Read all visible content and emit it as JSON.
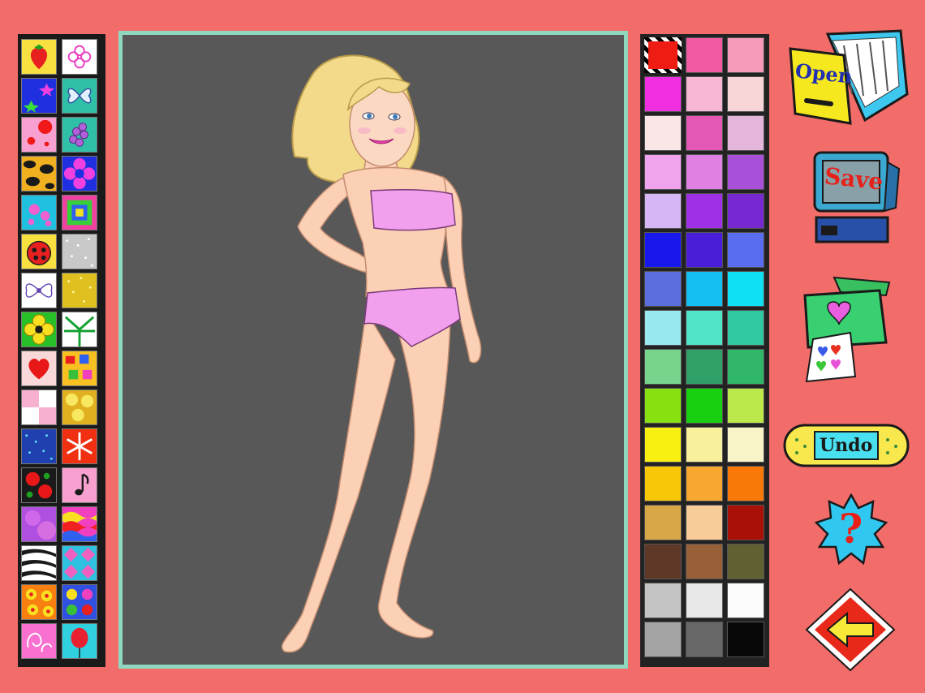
{
  "patterns": [
    {
      "name": "strawberry",
      "icon": "strawberry-icon"
    },
    {
      "name": "flower-outline",
      "icon": "flower-icon"
    },
    {
      "name": "stars-splat",
      "icon": "stars-icon"
    },
    {
      "name": "butterfly",
      "icon": "butterfly-icon"
    },
    {
      "name": "pink-dots",
      "icon": "dots-icon"
    },
    {
      "name": "grapes",
      "icon": "grapes-icon"
    },
    {
      "name": "leopard",
      "icon": "leopard-icon"
    },
    {
      "name": "purple-flower",
      "icon": "purple-flower-icon"
    },
    {
      "name": "poodle",
      "icon": "poodle-icon"
    },
    {
      "name": "squares",
      "icon": "squares-icon"
    },
    {
      "name": "ladybug",
      "icon": "ladybug-icon"
    },
    {
      "name": "silver-glitter",
      "icon": "glitter-icon"
    },
    {
      "name": "bow",
      "icon": "bow-icon"
    },
    {
      "name": "gold-glitter",
      "icon": "gold-glitter-icon"
    },
    {
      "name": "yellow-flower",
      "icon": "yellow-flower-icon"
    },
    {
      "name": "palm-leaves",
      "icon": "palm-icon"
    },
    {
      "name": "heart",
      "icon": "heart-icon"
    },
    {
      "name": "confetti",
      "icon": "confetti-icon"
    },
    {
      "name": "checker",
      "icon": "checker-icon"
    },
    {
      "name": "yellow-roses",
      "icon": "roses-icon"
    },
    {
      "name": "blue-speckle",
      "icon": "speckle-icon"
    },
    {
      "name": "snowflake",
      "icon": "snowflake-icon"
    },
    {
      "name": "red-roses",
      "icon": "red-roses-icon"
    },
    {
      "name": "music-note",
      "icon": "music-note-icon"
    },
    {
      "name": "purple-tie-dye",
      "icon": "tie-dye-icon"
    },
    {
      "name": "rainbow-waves",
      "icon": "waves-icon"
    },
    {
      "name": "zebra",
      "icon": "zebra-icon"
    },
    {
      "name": "blue-diamonds",
      "icon": "diamonds-icon"
    },
    {
      "name": "orange-flowers",
      "icon": "orange-flowers-icon"
    },
    {
      "name": "flower-mix",
      "icon": "flower-mix-icon"
    },
    {
      "name": "pink-paisley",
      "icon": "paisley-icon"
    },
    {
      "name": "balloon",
      "icon": "balloon-icon"
    }
  ],
  "palette": {
    "selected_index": 0,
    "colors": [
      "#ee1c12",
      "#f25aa4",
      "#f59ab8",
      "#f030e0",
      "#f7b6d4",
      "#f8d6d8",
      "#fae6e6",
      "#e258b4",
      "#e4b6dc",
      "#f0a4ee",
      "#e080e2",
      "#a850d8",
      "#d6b6f4",
      "#a030e6",
      "#7828d0",
      "#1818ec",
      "#4a1ed8",
      "#5a6cf0",
      "#5c6ede",
      "#14c0f0",
      "#10e0f4",
      "#98e8f0",
      "#50e4c8",
      "#30c8a0",
      "#78d48c",
      "#30a068",
      "#30b868",
      "#88e010",
      "#18d010",
      "#bce84c",
      "#f8f010",
      "#f8f09c",
      "#f8f4c8",
      "#f8c808",
      "#f8a830",
      "#f87808",
      "#d8a848",
      "#f8cc98",
      "#a81008",
      "#603828",
      "#986038",
      "#606030",
      "#c4c4c4",
      "#e8e8e8",
      "#fcfcfc",
      "#a4a4a4",
      "#686868",
      "#080808"
    ]
  },
  "tools": {
    "open_label": "Open",
    "save_label": "Save",
    "undo_label": "Undo",
    "help_glyph": "?"
  },
  "colors": {
    "background": "#f26c6a",
    "canvas": "#585858",
    "canvas_border": "#8fd8c0",
    "swimsuit": "#f2a0ee",
    "skin": "#fbd0b4",
    "hair": "#f2da8a"
  }
}
